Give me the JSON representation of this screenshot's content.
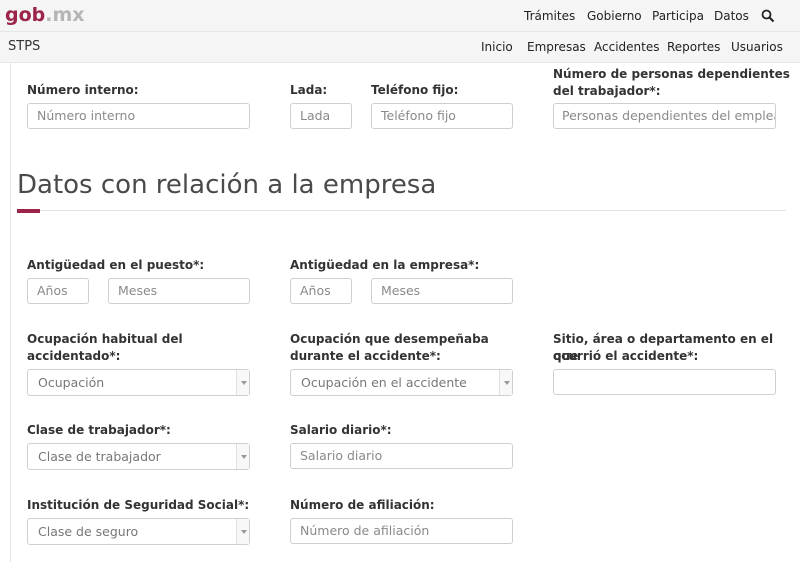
{
  "header": {
    "logo_main": "gob",
    "logo_tld": ".mx",
    "nav": [
      "Trámites",
      "Gobierno",
      "Participa",
      "Datos"
    ],
    "search_icon": "search-icon"
  },
  "subheader": {
    "brand": "STPS",
    "nav": [
      "Inicio",
      "Empresas",
      "Accidentes",
      "Reportes",
      "Usuarios"
    ]
  },
  "worker_fields": {
    "numero_interno_label": "Número interno:",
    "numero_interno_placeholder": "Número interno",
    "lada_label": "Lada:",
    "lada_placeholder": "Lada",
    "telefono_label": "Teléfono fijo:",
    "telefono_placeholder": "Teléfono fijo",
    "dependientes_label_1": "Número de personas dependientes",
    "dependientes_label_2": "del trabajador*:",
    "dependientes_placeholder": "Personas dependientes del empleado"
  },
  "section": {
    "title": "Datos con relación a la empresa",
    "accent_color": "#9d2449"
  },
  "company_fields": {
    "antig_puesto_label": "Antigüedad en el puesto*:",
    "antig_puesto_anos": "Años",
    "antig_puesto_meses": "Meses",
    "antig_empresa_label": "Antigüedad en la empresa*:",
    "antig_empresa_anos": "Años",
    "antig_empresa_meses": "Meses",
    "ocupacion_label_1": "Ocupación habitual del",
    "ocupacion_label_2": "accidentado*:",
    "ocupacion_value": "Ocupación",
    "ocup_accidente_label_1": "Ocupación que desempeñaba",
    "ocup_accidente_label_2": "durante el accidente*:",
    "ocup_accidente_value": "Ocupación en el accidente",
    "sitio_label_1": "Sitio, área o departamento en el que",
    "sitio_label_2": "ocurrió el accidente*:",
    "sitio_value": "",
    "clase_label": "Clase de trabajador*:",
    "clase_value": "Clase de trabajador",
    "salario_label": "Salario diario*:",
    "salario_placeholder": "Salario diario",
    "institucion_label": "Institución de Seguridad Social*:",
    "institucion_value": "Clase de seguro",
    "afiliacion_label": "Número de afiliación:",
    "afiliacion_placeholder": "Número de afiliación"
  }
}
